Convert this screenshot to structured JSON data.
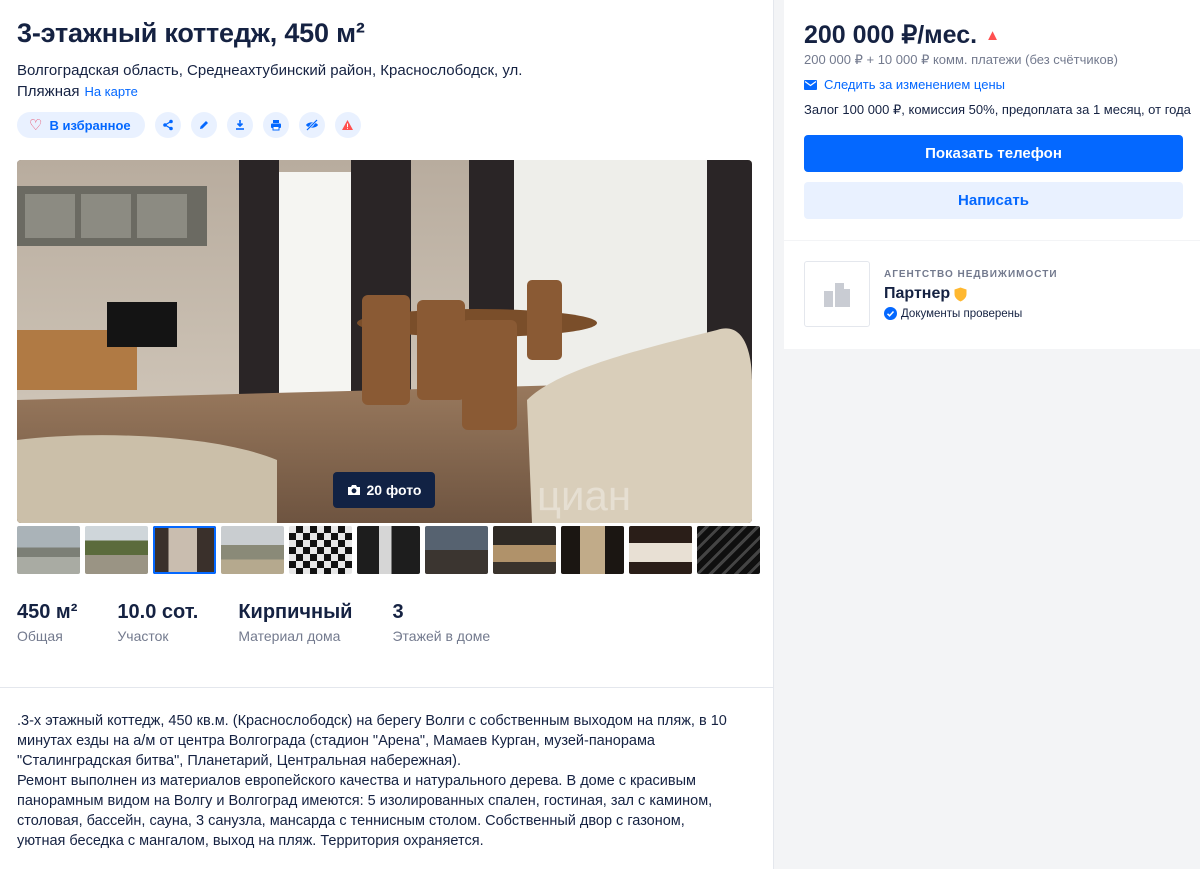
{
  "listing": {
    "title": "3-этажный коттедж, 450 м²",
    "address": "Волгоградская область, Среднеахтубинский район, Краснослободск, ул. Пляжная",
    "map_link": "На карте",
    "favorite_label": "В избранное",
    "action_icons": [
      "share-icon",
      "edit-icon",
      "download-icon",
      "print-icon",
      "hide-icon",
      "report-icon"
    ],
    "photo_count": "20 фото",
    "watermark": "циан",
    "thumbnails_count": 11,
    "active_thumbnail": 2
  },
  "facts": [
    {
      "value": "450 м²",
      "label": "Общая"
    },
    {
      "value": "10.0 сот.",
      "label": "Участок"
    },
    {
      "value": "Кирпичный",
      "label": "Материал дома"
    },
    {
      "value": "3",
      "label": "Этажей в доме"
    }
  ],
  "description": ".3-х этажный коттедж, 450 кв.м. (Краснослободск) на берегу Волги с собственным выходом на пляж, в 10 минутах езды на а/м от центра Волгограда (стадион \"Арена\", Мамаев Курган, музей-панорама \"Сталинградская битва\", Планетарий, Центральная набережная).\nРемонт выполнен из материалов европейского качества и натурального дерева. В доме с красивым панорамным видом на Волгу и Волгоград имеются: 5 изолированных спален, гостиная, зал с камином, столовая, бассейн, сауна, 3 санузла, мансарда с теннисным столом. Собственный двор с газоном, уютная беседка с мангалом, выход на пляж. Территория охраняется.",
  "price": {
    "main": "200 000 ₽/мес.",
    "sub": "200 000 ₽ + 10 000 ₽ комм. платежи (без счётчиков)",
    "follow": "Следить за изменением цены",
    "terms": "Залог 100 000 ₽, комиссия 50%, предоплата за 1 месяц, от года",
    "show_phone": "Показать телефон",
    "write": "Написать"
  },
  "agency": {
    "label": "АГЕНТСТВО НЕДВИЖИМОСТИ",
    "name": "Партнер",
    "verified": "Документы проверены"
  },
  "colors": {
    "accent": "#0468ff",
    "accent_light": "#e9f1ff",
    "text": "#152242",
    "muted": "#737a8e",
    "up_arrow": "#ff5050"
  }
}
